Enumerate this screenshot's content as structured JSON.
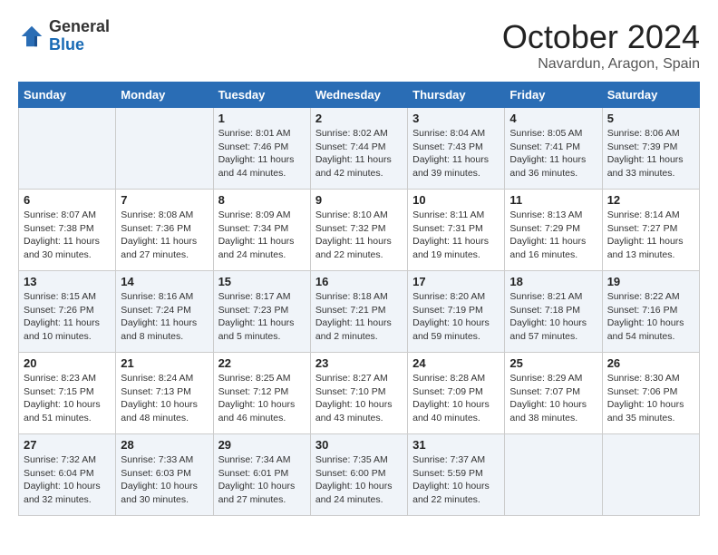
{
  "header": {
    "logo_general": "General",
    "logo_blue": "Blue",
    "month": "October 2024",
    "location": "Navardun, Aragon, Spain"
  },
  "weekdays": [
    "Sunday",
    "Monday",
    "Tuesday",
    "Wednesday",
    "Thursday",
    "Friday",
    "Saturday"
  ],
  "weeks": [
    [
      {
        "day": "",
        "info": ""
      },
      {
        "day": "",
        "info": ""
      },
      {
        "day": "1",
        "info": "Sunrise: 8:01 AM\nSunset: 7:46 PM\nDaylight: 11 hours and 44 minutes."
      },
      {
        "day": "2",
        "info": "Sunrise: 8:02 AM\nSunset: 7:44 PM\nDaylight: 11 hours and 42 minutes."
      },
      {
        "day": "3",
        "info": "Sunrise: 8:04 AM\nSunset: 7:43 PM\nDaylight: 11 hours and 39 minutes."
      },
      {
        "day": "4",
        "info": "Sunrise: 8:05 AM\nSunset: 7:41 PM\nDaylight: 11 hours and 36 minutes."
      },
      {
        "day": "5",
        "info": "Sunrise: 8:06 AM\nSunset: 7:39 PM\nDaylight: 11 hours and 33 minutes."
      }
    ],
    [
      {
        "day": "6",
        "info": "Sunrise: 8:07 AM\nSunset: 7:38 PM\nDaylight: 11 hours and 30 minutes."
      },
      {
        "day": "7",
        "info": "Sunrise: 8:08 AM\nSunset: 7:36 PM\nDaylight: 11 hours and 27 minutes."
      },
      {
        "day": "8",
        "info": "Sunrise: 8:09 AM\nSunset: 7:34 PM\nDaylight: 11 hours and 24 minutes."
      },
      {
        "day": "9",
        "info": "Sunrise: 8:10 AM\nSunset: 7:32 PM\nDaylight: 11 hours and 22 minutes."
      },
      {
        "day": "10",
        "info": "Sunrise: 8:11 AM\nSunset: 7:31 PM\nDaylight: 11 hours and 19 minutes."
      },
      {
        "day": "11",
        "info": "Sunrise: 8:13 AM\nSunset: 7:29 PM\nDaylight: 11 hours and 16 minutes."
      },
      {
        "day": "12",
        "info": "Sunrise: 8:14 AM\nSunset: 7:27 PM\nDaylight: 11 hours and 13 minutes."
      }
    ],
    [
      {
        "day": "13",
        "info": "Sunrise: 8:15 AM\nSunset: 7:26 PM\nDaylight: 11 hours and 10 minutes."
      },
      {
        "day": "14",
        "info": "Sunrise: 8:16 AM\nSunset: 7:24 PM\nDaylight: 11 hours and 8 minutes."
      },
      {
        "day": "15",
        "info": "Sunrise: 8:17 AM\nSunset: 7:23 PM\nDaylight: 11 hours and 5 minutes."
      },
      {
        "day": "16",
        "info": "Sunrise: 8:18 AM\nSunset: 7:21 PM\nDaylight: 11 hours and 2 minutes."
      },
      {
        "day": "17",
        "info": "Sunrise: 8:20 AM\nSunset: 7:19 PM\nDaylight: 10 hours and 59 minutes."
      },
      {
        "day": "18",
        "info": "Sunrise: 8:21 AM\nSunset: 7:18 PM\nDaylight: 10 hours and 57 minutes."
      },
      {
        "day": "19",
        "info": "Sunrise: 8:22 AM\nSunset: 7:16 PM\nDaylight: 10 hours and 54 minutes."
      }
    ],
    [
      {
        "day": "20",
        "info": "Sunrise: 8:23 AM\nSunset: 7:15 PM\nDaylight: 10 hours and 51 minutes."
      },
      {
        "day": "21",
        "info": "Sunrise: 8:24 AM\nSunset: 7:13 PM\nDaylight: 10 hours and 48 minutes."
      },
      {
        "day": "22",
        "info": "Sunrise: 8:25 AM\nSunset: 7:12 PM\nDaylight: 10 hours and 46 minutes."
      },
      {
        "day": "23",
        "info": "Sunrise: 8:27 AM\nSunset: 7:10 PM\nDaylight: 10 hours and 43 minutes."
      },
      {
        "day": "24",
        "info": "Sunrise: 8:28 AM\nSunset: 7:09 PM\nDaylight: 10 hours and 40 minutes."
      },
      {
        "day": "25",
        "info": "Sunrise: 8:29 AM\nSunset: 7:07 PM\nDaylight: 10 hours and 38 minutes."
      },
      {
        "day": "26",
        "info": "Sunrise: 8:30 AM\nSunset: 7:06 PM\nDaylight: 10 hours and 35 minutes."
      }
    ],
    [
      {
        "day": "27",
        "info": "Sunrise: 7:32 AM\nSunset: 6:04 PM\nDaylight: 10 hours and 32 minutes."
      },
      {
        "day": "28",
        "info": "Sunrise: 7:33 AM\nSunset: 6:03 PM\nDaylight: 10 hours and 30 minutes."
      },
      {
        "day": "29",
        "info": "Sunrise: 7:34 AM\nSunset: 6:01 PM\nDaylight: 10 hours and 27 minutes."
      },
      {
        "day": "30",
        "info": "Sunrise: 7:35 AM\nSunset: 6:00 PM\nDaylight: 10 hours and 24 minutes."
      },
      {
        "day": "31",
        "info": "Sunrise: 7:37 AM\nSunset: 5:59 PM\nDaylight: 10 hours and 22 minutes."
      },
      {
        "day": "",
        "info": ""
      },
      {
        "day": "",
        "info": ""
      }
    ]
  ]
}
